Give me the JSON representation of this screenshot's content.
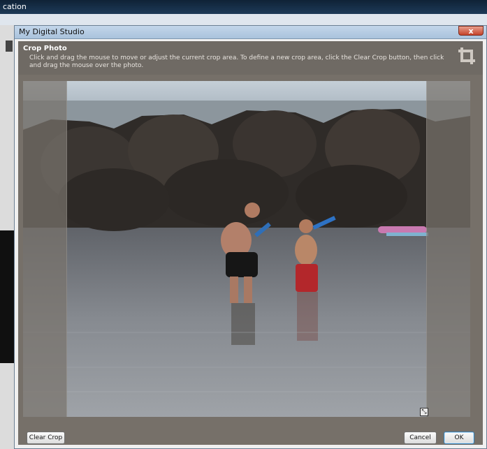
{
  "background_app": {
    "title_fragment": "cation"
  },
  "dialog": {
    "title": "My Digital Studio",
    "close_label": "x"
  },
  "header": {
    "title": "Crop Photo",
    "description": "Click and drag the mouse to move or adjust the current crop area. To define a new crop area, click the Clear Crop button, then click and drag the mouse over the photo."
  },
  "icons": {
    "crop": "crop-icon",
    "resize": "resize-handle-icon"
  },
  "buttons": {
    "clear_crop": "Clear Crop",
    "cancel": "Cancel",
    "ok": "OK"
  },
  "colors": {
    "panel": "#767069",
    "header": "#6f6a64",
    "titlebar": "#a9c2dc",
    "close": "#c5432a"
  }
}
